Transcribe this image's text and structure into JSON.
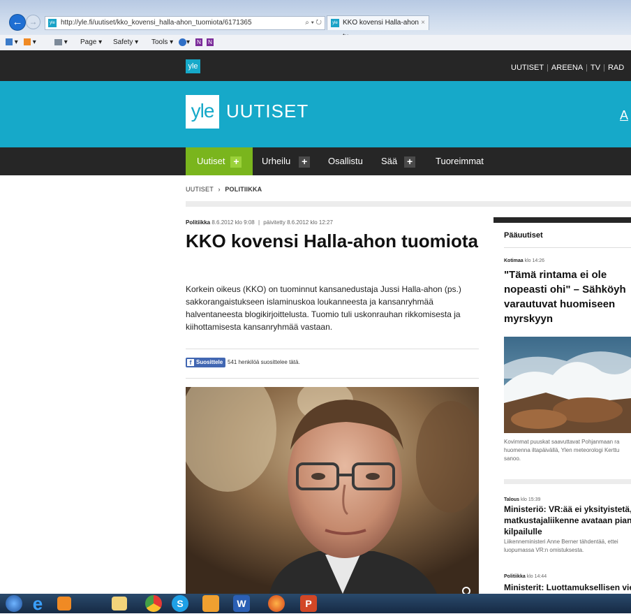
{
  "browser": {
    "url": "http://yle.fi/uutiset/kko_kovensi_halla-ahon_tuomiota/6171365",
    "url_domain": "yle.fi",
    "address_tools": "⌕ ▾ ↻",
    "tab_title": "KKO kovensi Halla-ahon tu...",
    "tab_close": "×",
    "favicon_text": "yle",
    "back_glyph": "←",
    "forward_glyph": "→",
    "command": {
      "page": "Page ▾",
      "safety": "Safety ▾",
      "tools": "Tools ▾",
      "dropdown": "▾",
      "onenote": "N"
    }
  },
  "topbar": {
    "logo": "yle",
    "nav": [
      "UUTISET",
      "AREENA",
      "TV",
      "RAD"
    ]
  },
  "banner": {
    "logo": "yle",
    "section": "UUTISET",
    "cut_letter": "A"
  },
  "mainnav": {
    "items": [
      "Uutiset",
      "Urheilu",
      "Osallistu",
      "Sää",
      "Tuoreimmat"
    ],
    "plus": "+"
  },
  "breadcrumb": {
    "root": "UUTISET",
    "sep": "›",
    "current": "POLITIIKKA"
  },
  "article": {
    "category": "Politiikka",
    "published": "8.6.2012 klo 9:08",
    "meta_sep": "|",
    "updated": "päivitetty 8.6.2012 klo 12:27",
    "title": "KKO kovensi Halla-ahon tuomiota",
    "lead": "Korkein oikeus (KKO) on tuominnut kansanedustaja Jussi Halla-ahon (ps.) sakkorangaistukseen islaminuskoa loukanneesta ja kansanryhmää halventaneesta blogikirjoittelusta. Tuomio tuli uskonrauhan rikkomisesta ja kiihottamisesta kansanryhmää vastaan.",
    "fb_label": "Suosittele",
    "fb_count": "541 henkilöä suosittelee tätä."
  },
  "sidebar": {
    "heading": "Pääuutiset",
    "items": [
      {
        "category": "Kotimaa",
        "time": "klo 14:26",
        "title_lines": [
          "\"Tämä rintama ei ole",
          "nopeasti ohi\" – Sähköyh",
          "varautuvat huomiseen",
          "myrskyyn"
        ],
        "caption_lines": [
          "Kovimmat puuskat saavuttavat Pohjanmaan ra",
          "huomenna iltapäivällä, Ylen meteorologi Kerttu",
          "sanoo."
        ]
      },
      {
        "category": "Talous",
        "time": "klo 15:39",
        "title_lines": [
          "Ministeriö: VR:ää ei yksityistetä,",
          "matkustajaliikenne avataan pian",
          "kilpailulle"
        ],
        "caption_lines": [
          "Liikenneministeri Anne Berner tähdentää, ettei",
          "luopumassa VR:n omistuksesta."
        ]
      },
      {
        "category": "Politiikka",
        "time": "klo 14:44",
        "title_lines": [
          "Ministerit: Luottamuksellisen vies"
        ]
      }
    ]
  },
  "taskbar": {
    "icons": [
      "windows-start-icon",
      "internet-explorer-icon",
      "media-player-icon",
      "file-explorer-icon",
      "chrome-icon",
      "skype-icon",
      "outlook-icon",
      "word-icon",
      "firefox-icon",
      "powerpoint-icon"
    ]
  }
}
